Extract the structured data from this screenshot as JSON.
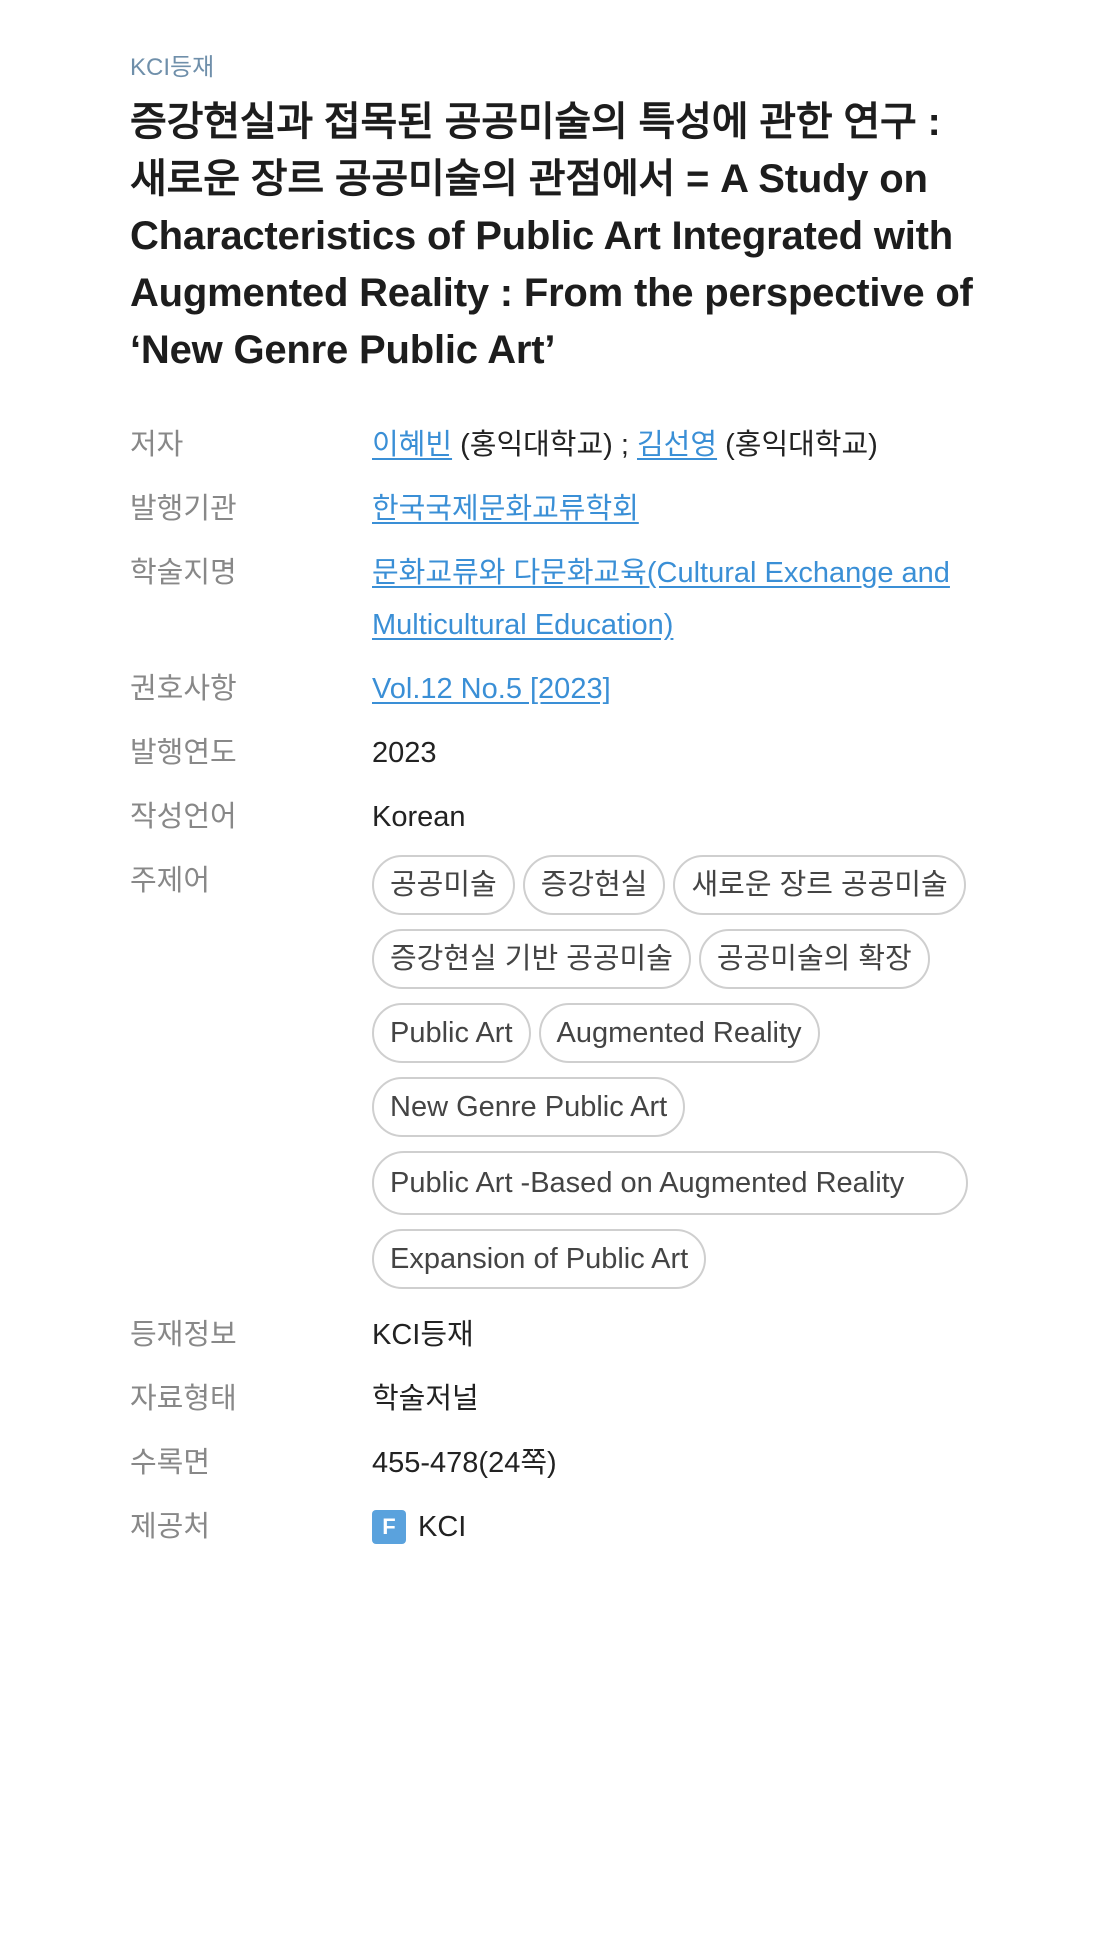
{
  "header": {
    "badge": "KCI등재",
    "title": "증강현실과 접목된 공공미술의 특성에 관한 연구 : 새로운 장르 공공미술의 관점에서 = A Study on Characteristics of Public Art Integrated with Augmented Reality : From the perspective of ‘New Genre Public Art’"
  },
  "labels": {
    "author": "저자",
    "publisher": "발행기관",
    "journal": "학술지명",
    "volume": "권호사항",
    "year": "발행연도",
    "language": "작성언어",
    "keywords": "주제어",
    "registration": "등재정보",
    "type": "자료형태",
    "pages": "수록면",
    "provider": "제공처"
  },
  "authors": [
    {
      "name": "이혜빈",
      "affiliation": "(홍익대학교)"
    },
    {
      "name": "김선영",
      "affiliation": "(홍익대학교)"
    }
  ],
  "author_separator": " ; ",
  "publisher": "한국국제문화교류학회",
  "journal": "문화교류와 다문화교육(Cultural Exchange and Multicultural Education)",
  "volume": "Vol.12 No.5 [2023]",
  "year": "2023",
  "language": "Korean",
  "keywords": [
    "공공미술",
    "증강현실",
    "새로운 장르 공공미술",
    "증강현실 기반 공공미술",
    "공공미술의 확장",
    "Public Art",
    "Augmented Reality",
    "New Genre Public Art",
    "Public Art -Based on Augmented Reality",
    "Expansion of Public Art"
  ],
  "registration": "KCI등재",
  "type": "학술저널",
  "pages": "455-478(24쪽)",
  "provider": {
    "icon": "F",
    "name": "KCI",
    "icon_color": "#5aa2dd"
  },
  "colors": {
    "link": "#3a8fd6",
    "label": "#888888",
    "badge": "#6f8faa"
  }
}
